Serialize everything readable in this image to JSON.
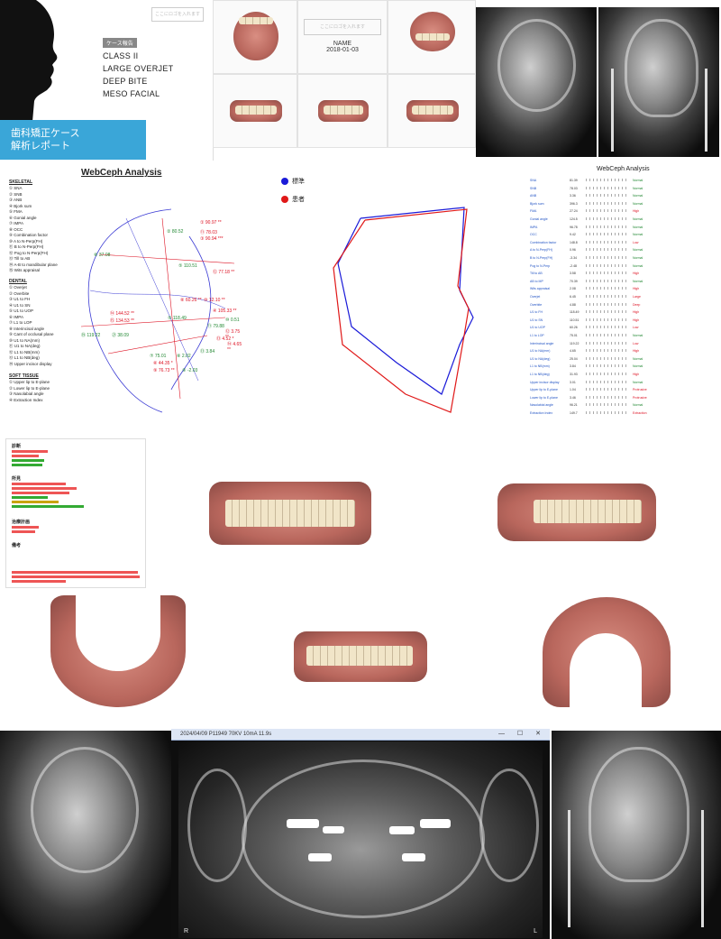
{
  "cover": {
    "badge": "ケース報告",
    "diagnosis": [
      "CLASS II",
      "LARGE OVERJET",
      "DEEP BITE",
      "MESO FACIAL"
    ],
    "title_lines": [
      "歯科矯正ケース",
      "解析レポート"
    ],
    "top_box": "ここにロゴを入れます",
    "date_box": "ここにロゴを入れます",
    "name": "NAME",
    "date": "2018-01-03"
  },
  "webceph": {
    "title": "WebCeph Analysis",
    "skeletal_header": "SKELETAL",
    "skeletal": [
      "① SNA",
      "② SNB",
      "③ ANB",
      "④ Bjork sum",
      "⑤ FMA",
      "⑥ Gonial angle",
      "⑦ IMPA",
      "⑧ OCC",
      "⑨ Combination factor",
      "⑩ A to N-Perp(FH)",
      "⑪ B to N-Perp(FH)",
      "⑫ Pog to N-Perp(FH)",
      "⑬ Till to AB",
      "⑭ A-B to mandibular plane",
      "⑮ Wits appraisal"
    ],
    "dental_header": "DENTAL",
    "dental": [
      "① Overjet",
      "② Overbite",
      "③ U1 to FH",
      "④ U1 to SN",
      "⑤ U1 to UOP",
      "⑥ IMPA",
      "⑦ L1 to LOP",
      "⑧ Interincisal angle",
      "⑨ Cant of occlusal plane",
      "⑩ U1 to NA(mm)",
      "⑪ U1 to NA(deg)",
      "⑫ L1 to NB(mm)",
      "⑬ L1 to NB(deg)",
      "⑭ Upper incisor display"
    ],
    "soft_header": "SOFT TISSUE",
    "soft": [
      "① Upper lip to E-plane",
      "② Lower lip to E-plane",
      "③ Nasolabial angle",
      "④ Extraction Index"
    ],
    "labels_red": [
      "① 90.97 **",
      "⑪ 78.03",
      "③ 90.94 ***",
      "⑫ 77.18 **",
      "⑧ 60.26 **",
      "⑩ 12.10 **",
      "④ 105.33 **",
      "⑭ 144.52 **",
      "⑮ 134.53 **",
      "⑫ 3.75 **",
      "⑬ 4.52 *",
      "⑭ 4.65 **",
      "⑥ 44.35 *",
      "⑨ 76.73 **"
    ],
    "labels_grn": [
      "② 80.52",
      "⑥ 37.08",
      "⑤ 110.51",
      "⑤ 118.49",
      "⑲ 119.22",
      "㉑ 38.09",
      "⑦ 75.01",
      "⑧ 2.02",
      "⑨ -2.03",
      "⑩ 0.51",
      "⑪ 79.88",
      "⑬ 3.84"
    ]
  },
  "polygon": {
    "legend": [
      {
        "label": "標準",
        "color": "#1a1ad8"
      },
      {
        "label": "患者",
        "color": "#e01818"
      }
    ]
  },
  "table": {
    "title": "WebCeph Analysis",
    "rows": [
      [
        "SNA",
        "81.39",
        "Normal"
      ],
      [
        "SNB",
        "78.03",
        "Normal"
      ],
      [
        "ANB",
        "3.36",
        "Normal"
      ],
      [
        "Bjork sum",
        "396.3",
        "Normal"
      ],
      [
        "FMA",
        "27.24",
        "High"
      ],
      [
        "Gonial angle",
        "124.5",
        "Normal"
      ],
      [
        "IMPA",
        "96.78",
        "Normal"
      ],
      [
        "OCC",
        "9.42",
        "Normal"
      ],
      [
        "Combination factor",
        "148.8",
        "Low"
      ],
      [
        "A to N-Perp(FH)",
        "0.96",
        "Normal"
      ],
      [
        "B to N-Perp(FH)",
        "-3.34",
        "Normal"
      ],
      [
        "Pog to N-Perp",
        "-2.48",
        "Normal"
      ],
      [
        "Till to AB",
        "3.58",
        "High"
      ],
      [
        "AB to MP",
        "70.39",
        "Normal"
      ],
      [
        "Wits appraisal",
        "2.08",
        "High"
      ],
      [
        "Overjet",
        "6.45",
        "Large"
      ],
      [
        "Overbite",
        "4.88",
        "Deep"
      ],
      [
        "U1 to FH",
        "118.49",
        "High"
      ],
      [
        "U1 to SN",
        "110.51",
        "High"
      ],
      [
        "U1 to UOP",
        "60.26",
        "Low"
      ],
      [
        "L1 to LOP",
        "75.01",
        "Normal"
      ],
      [
        "Interincisal angle",
        "119.22",
        "Low"
      ],
      [
        "U1 to NA(mm)",
        "4.65",
        "High"
      ],
      [
        "U1 to NA(deg)",
        "25.04",
        "Normal"
      ],
      [
        "L1 to NB(mm)",
        "3.84",
        "Normal"
      ],
      [
        "L1 to NB(deg)",
        "31.93",
        "High"
      ],
      [
        "Upper incisor display",
        "3.01",
        "Normal"
      ],
      [
        "Upper lip to E-plane",
        "1.04",
        "Protrusive"
      ],
      [
        "Lower lip to E-plane",
        "3.46",
        "Protrusive"
      ],
      [
        "Nasolabial angle",
        "96.21",
        "Normal"
      ],
      [
        "Extraction Index",
        "149.7",
        "Extraction"
      ]
    ]
  },
  "report": {
    "section1": "診断",
    "section2": "所見",
    "section3": "治療計画",
    "section4": "備考"
  },
  "pano": {
    "titlebar": "2024/04/09 P11949 70KV 10mA 11.9s",
    "left_mark": "R",
    "right_mark": "L",
    "controls": "— ☐ ✕"
  },
  "colors": {
    "accent": "#3aa6d8",
    "normal": "#1a1ad8",
    "patient": "#e01818"
  }
}
